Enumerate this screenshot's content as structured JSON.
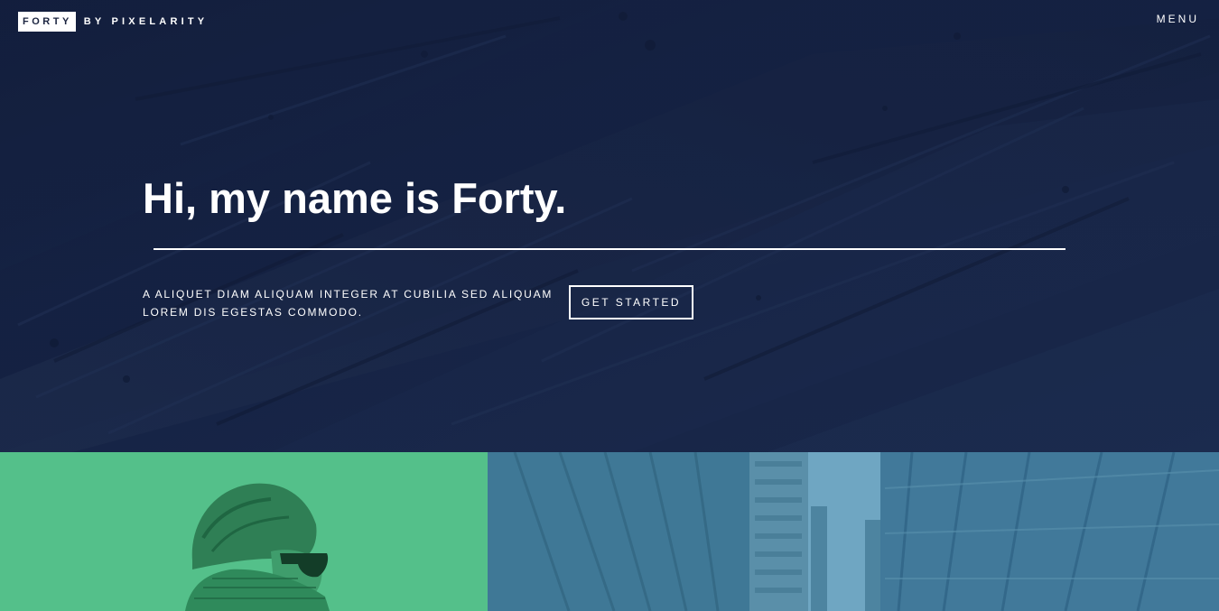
{
  "header": {
    "logo_box": "FORTY",
    "logo_rest": "BY PIXELARITY",
    "menu_label": "MENU"
  },
  "banner": {
    "title": "Hi, my name is Forty.",
    "text": "A ALIQUET DIAM ALIQUAM INTEGER AT CUBILIA SED ALIQUAM LOREM DIS EGESTAS COMMODO.",
    "button_label": "GET STARTED"
  },
  "tiles": [
    {
      "accent": "#54c08a",
      "subject": "person-with-sunglasses"
    },
    {
      "accent": "#4e87a3",
      "subject": "city-buildings"
    }
  ],
  "colors": {
    "banner_overlay": "#1c2a4a",
    "text": "#ffffff"
  }
}
